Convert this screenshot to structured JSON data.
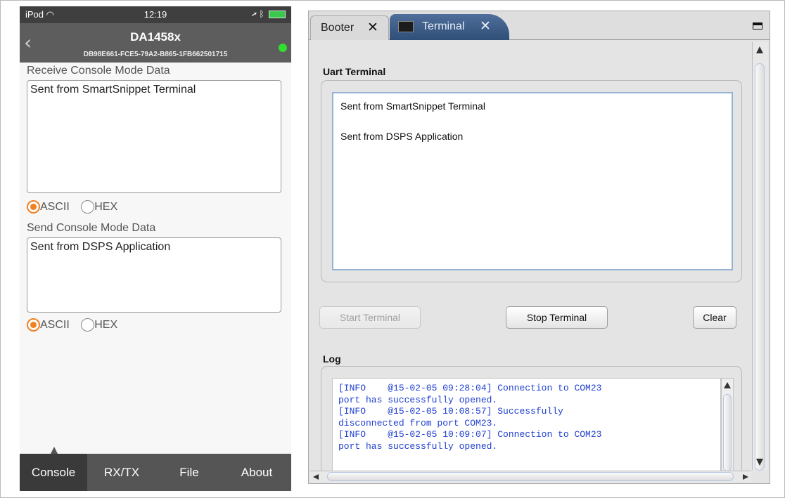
{
  "phone": {
    "status": {
      "device": "iPod",
      "time": "12:19"
    },
    "nav": {
      "title": "DA1458x",
      "subtitle": "DB98E661-FCE5-79A2-B865-1FB662501715"
    },
    "receive": {
      "label": "Receive Console Mode Data",
      "text": "Sent from SmartSnippet Terminal",
      "opt1": "ASCII",
      "opt2": "HEX",
      "selected": "ASCII"
    },
    "send": {
      "label": "Send Console Mode Data",
      "text": "Sent from DSPS Application",
      "opt1": "ASCII",
      "opt2": "HEX",
      "selected": "ASCII"
    },
    "tabs": [
      "Console",
      "RX/TX",
      "File",
      "About"
    ],
    "active_tab": "Console",
    "colors": {
      "accent": "#f08020",
      "connected": "#2fe02f",
      "navbar": "#5d5d5d",
      "tabbar": "#555555"
    }
  },
  "app": {
    "tabs": {
      "booter": "Booter",
      "terminal": "Terminal"
    },
    "uart_label": "Uart Terminal",
    "uart_lines": [
      "Sent from SmartSnippet Terminal",
      "Sent from DSPS Application"
    ],
    "buttons": {
      "start": "Start Terminal",
      "stop": "Stop Terminal",
      "clear": "Clear"
    },
    "log_label": "Log",
    "log_text": "[INFO    @15-02-05 09:28:04] Connection to COM23\nport has successfully opened.\n[INFO    @15-02-05 10:08:57] Successfully\ndisconnected from port COM23.\n[INFO    @15-02-05 10:09:07] Connection to COM23\nport has successfully opened.",
    "colors": {
      "active_tab": "#2f4e78",
      "log_text": "#1f3fd0",
      "focus_border": "#96b3d6"
    }
  }
}
